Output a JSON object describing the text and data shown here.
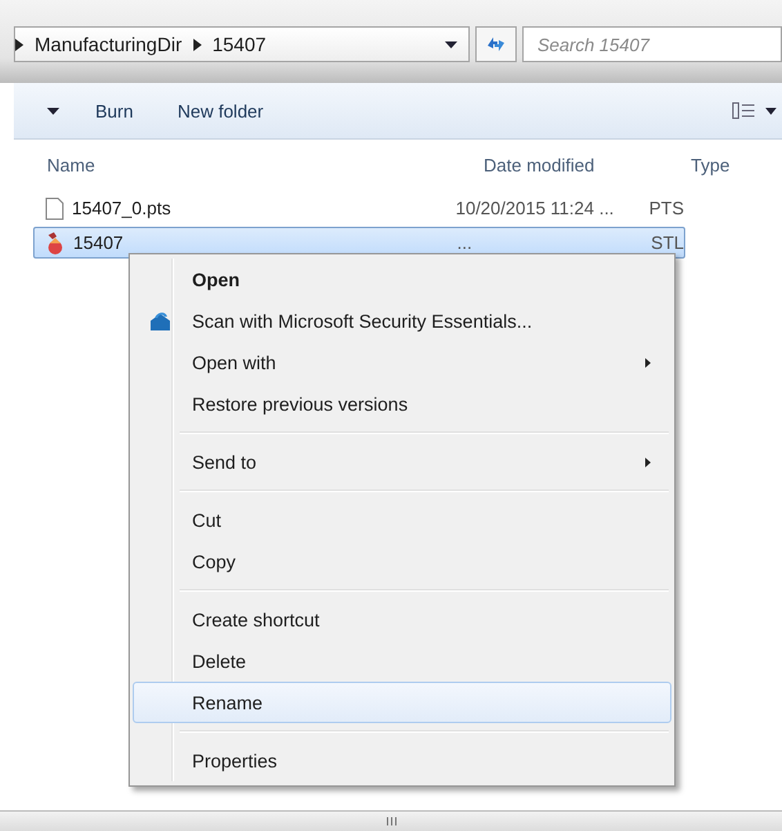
{
  "address_bar": {
    "crumbs": [
      "ManufacturingDir",
      "15407"
    ]
  },
  "search": {
    "placeholder": "Search 15407"
  },
  "toolbar": {
    "buttons": [
      "Burn",
      "New folder"
    ]
  },
  "table": {
    "columns": [
      "Name",
      "Date modified",
      "Type"
    ],
    "rows": [
      {
        "name": "15407_0.pts",
        "date_modified": "10/20/2015 11:24 ...",
        "type": "PTS",
        "kind": "document",
        "selected": false
      },
      {
        "name": "15407",
        "date_modified": "...",
        "type": "STL",
        "kind": "model",
        "selected": true
      }
    ]
  },
  "context_menu": [
    {
      "kind": "item",
      "label": "Open",
      "bold": true,
      "submenu": false,
      "selected": false
    },
    {
      "kind": "icon_item",
      "label": "Scan with Microsoft Security Essentials...",
      "bold": false,
      "submenu": false,
      "selected": false
    },
    {
      "kind": "item",
      "label": "Open with",
      "bold": false,
      "submenu": true,
      "selected": false
    },
    {
      "kind": "item",
      "label": "Restore previous versions",
      "bold": false,
      "submenu": false,
      "selected": false
    },
    {
      "kind": "separator"
    },
    {
      "kind": "item",
      "label": "Send to",
      "bold": false,
      "submenu": true,
      "selected": false
    },
    {
      "kind": "separator"
    },
    {
      "kind": "item",
      "label": "Cut",
      "bold": false,
      "submenu": false,
      "selected": false
    },
    {
      "kind": "item",
      "label": "Copy",
      "bold": false,
      "submenu": false,
      "selected": false
    },
    {
      "kind": "separator"
    },
    {
      "kind": "item",
      "label": "Create shortcut",
      "bold": false,
      "submenu": false,
      "selected": false
    },
    {
      "kind": "item",
      "label": "Delete",
      "bold": false,
      "submenu": false,
      "selected": false
    },
    {
      "kind": "item",
      "label": "Rename",
      "bold": false,
      "submenu": false,
      "selected": true
    },
    {
      "kind": "separator"
    },
    {
      "kind": "item",
      "label": "Properties",
      "bold": false,
      "submenu": false,
      "selected": false
    }
  ]
}
